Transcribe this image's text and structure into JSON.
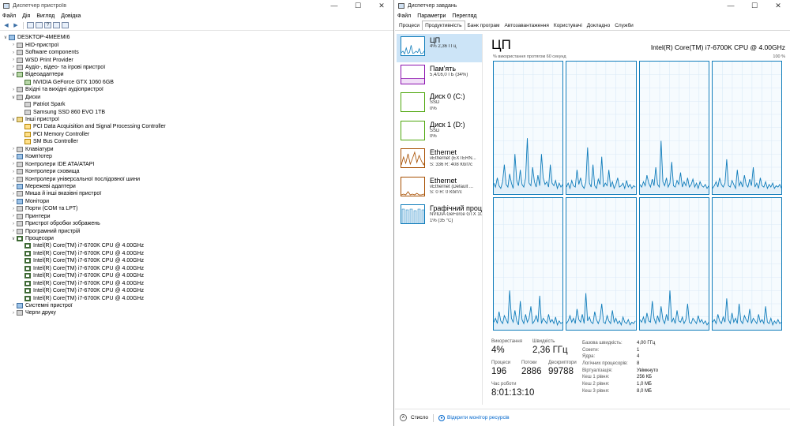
{
  "device_manager": {
    "title": "Диспетчер пристроїв",
    "menu": [
      "Файл",
      "Дія",
      "Вигляд",
      "Довідка"
    ],
    "tree": [
      {
        "depth": 0,
        "expand": "open",
        "icon": "computer-icon",
        "label": "DESKTOP-4MEEMI6"
      },
      {
        "depth": 1,
        "expand": "closed",
        "icon": "hid-icon",
        "label": "HID-пристрої"
      },
      {
        "depth": 1,
        "expand": "closed",
        "icon": "software-components-icon",
        "label": "Software components"
      },
      {
        "depth": 1,
        "expand": "closed",
        "icon": "printer-icon",
        "label": "WSD Print Provider"
      },
      {
        "depth": 1,
        "expand": "closed",
        "icon": "speaker-icon",
        "label": "Аудіо-, відео- та ігрові пристрої"
      },
      {
        "depth": 1,
        "expand": "open",
        "icon": "display-adapter-icon",
        "label": "Відеоадаптери"
      },
      {
        "depth": 2,
        "expand": "none",
        "icon": "display-adapter-icon",
        "label": "NVIDIA GeForce GTX 1060 6GB"
      },
      {
        "depth": 1,
        "expand": "closed",
        "icon": "audio-io-icon",
        "label": "Вхідні та вихідні аудіопристрої"
      },
      {
        "depth": 1,
        "expand": "open",
        "icon": "disk-icon",
        "label": "Диски"
      },
      {
        "depth": 2,
        "expand": "none",
        "icon": "disk-icon",
        "label": "Patriot Spark"
      },
      {
        "depth": 2,
        "expand": "none",
        "icon": "disk-icon",
        "label": "Samsung SSD 860 EVO 1TB"
      },
      {
        "depth": 1,
        "expand": "open",
        "icon": "other-devices-icon",
        "label": "Інші пристрої"
      },
      {
        "depth": 2,
        "expand": "none",
        "icon": "warning-device-icon",
        "label": "PCI Data Acquisition and Signal Processing Controller"
      },
      {
        "depth": 2,
        "expand": "none",
        "icon": "warning-device-icon",
        "label": "PCI Memory Controller"
      },
      {
        "depth": 2,
        "expand": "none",
        "icon": "warning-device-icon",
        "label": "SM Bus Controller"
      },
      {
        "depth": 1,
        "expand": "closed",
        "icon": "keyboard-icon",
        "label": "Клавіатури"
      },
      {
        "depth": 1,
        "expand": "closed",
        "icon": "computer-icon",
        "label": "Комп'ютер"
      },
      {
        "depth": 1,
        "expand": "closed",
        "icon": "ide-controller-icon",
        "label": "Контролери IDE ATA/ATAPI"
      },
      {
        "depth": 1,
        "expand": "closed",
        "icon": "storage-controller-icon",
        "label": "Контролери сховища"
      },
      {
        "depth": 1,
        "expand": "closed",
        "icon": "usb-controller-icon",
        "label": "Контролери універсальної послідовної шини"
      },
      {
        "depth": 1,
        "expand": "closed",
        "icon": "network-adapter-icon",
        "label": "Мережеві адаптери"
      },
      {
        "depth": 1,
        "expand": "closed",
        "icon": "mouse-icon",
        "label": "Миша й інші вказівні пристрої"
      },
      {
        "depth": 1,
        "expand": "closed",
        "icon": "monitor-icon",
        "label": "Монітори"
      },
      {
        "depth": 1,
        "expand": "closed",
        "icon": "port-icon",
        "label": "Порти (COM та LPT)"
      },
      {
        "depth": 1,
        "expand": "closed",
        "icon": "printer-icon",
        "label": "Принтери"
      },
      {
        "depth": 1,
        "expand": "closed",
        "icon": "imaging-device-icon",
        "label": "Пристрої обробки зображень"
      },
      {
        "depth": 1,
        "expand": "closed",
        "icon": "software-device-icon",
        "label": "Програмний пристрій"
      },
      {
        "depth": 1,
        "expand": "open",
        "icon": "processor-icon",
        "label": "Процесори"
      },
      {
        "depth": 2,
        "expand": "none",
        "icon": "processor-icon",
        "label": "Intel(R) Core(TM) i7-6700K CPU @ 4.00GHz"
      },
      {
        "depth": 2,
        "expand": "none",
        "icon": "processor-icon",
        "label": "Intel(R) Core(TM) i7-6700K CPU @ 4.00GHz"
      },
      {
        "depth": 2,
        "expand": "none",
        "icon": "processor-icon",
        "label": "Intel(R) Core(TM) i7-6700K CPU @ 4.00GHz"
      },
      {
        "depth": 2,
        "expand": "none",
        "icon": "processor-icon",
        "label": "Intel(R) Core(TM) i7-6700K CPU @ 4.00GHz"
      },
      {
        "depth": 2,
        "expand": "none",
        "icon": "processor-icon",
        "label": "Intel(R) Core(TM) i7-6700K CPU @ 4.00GHz"
      },
      {
        "depth": 2,
        "expand": "none",
        "icon": "processor-icon",
        "label": "Intel(R) Core(TM) i7-6700K CPU @ 4.00GHz"
      },
      {
        "depth": 2,
        "expand": "none",
        "icon": "processor-icon",
        "label": "Intel(R) Core(TM) i7-6700K CPU @ 4.00GHz"
      },
      {
        "depth": 2,
        "expand": "none",
        "icon": "processor-icon",
        "label": "Intel(R) Core(TM) i7-6700K CPU @ 4.00GHz"
      },
      {
        "depth": 1,
        "expand": "closed",
        "icon": "system-devices-icon",
        "label": "Системні пристрої"
      },
      {
        "depth": 1,
        "expand": "closed",
        "icon": "print-queue-icon",
        "label": "Черги друку"
      }
    ]
  },
  "task_manager": {
    "title": "Диспетчер завдань",
    "menu": [
      "Файл",
      "Параметри",
      "Перегляд"
    ],
    "tabs": [
      "Процеси",
      "Продуктивність",
      "Банк програм",
      "Автозавантаження",
      "Користувачі",
      "Докладно",
      "Служби"
    ],
    "active_tab": "Продуктивність",
    "sidebar": [
      {
        "name": "ЦП",
        "sub1": "4% 2,36 ГГц",
        "sub2": "",
        "kind": "cpu",
        "selected": true
      },
      {
        "name": "Пам'ять",
        "sub1": "5,4/16,0 ГБ (34%)",
        "sub2": "",
        "kind": "mem",
        "selected": false
      },
      {
        "name": "Диск 0 (C:)",
        "sub1": "SSD",
        "sub2": "0%",
        "kind": "disk",
        "selected": false
      },
      {
        "name": "Диск 1 (D:)",
        "sub1": "SSD",
        "sub2": "0%",
        "kind": "disk",
        "selected": false
      },
      {
        "name": "Ethernet",
        "sub1": "vEthernet (EXTERN...",
        "sub2": "S: 336 R: 408 Кбіт/с",
        "kind": "net",
        "selected": false
      },
      {
        "name": "Ethernet",
        "sub1": "vEthernet (Default ...",
        "sub2": "S: 0 R: 0 Кбіт/с",
        "kind": "net",
        "selected": false
      },
      {
        "name": "Графічний процес",
        "sub1": "NVIDIA GeForce GTX 106",
        "sub2": "1% (35 °C)",
        "kind": "gpu",
        "selected": false
      }
    ],
    "cpu": {
      "title": "ЦП",
      "model": "Intel(R) Core(TM) i7-6700K CPU @ 4.00GHz",
      "graph_caption": "% використання протягом 60 секунд",
      "graph_max": "100 %",
      "stats": {
        "utilization_label": "Використання",
        "utilization": "4%",
        "speed_label": "Швидкість",
        "speed": "2,36 ГГц",
        "processes_label": "Процеси",
        "processes": "196",
        "threads_label": "Потоки",
        "threads": "2886",
        "handles_label": "Дескриптори",
        "handles": "99788",
        "uptime_label": "Час роботи",
        "uptime": "8:01:13:10"
      },
      "details": [
        {
          "k": "Базова швидкість:",
          "v": "4,00 ГГц"
        },
        {
          "k": "Сокети:",
          "v": "1"
        },
        {
          "k": "Ядра:",
          "v": "4"
        },
        {
          "k": "Логічних процесорів:",
          "v": "8"
        },
        {
          "k": "Віртуалізація:",
          "v": "Увімкнуто"
        },
        {
          "k": "Кеш 1 рівня:",
          "v": "256 КБ"
        },
        {
          "k": "Кеш 2 рівня:",
          "v": "1,0 МБ"
        },
        {
          "k": "Кеш 3 рівня:",
          "v": "8,0 МБ"
        }
      ],
      "core_series": [
        [
          8,
          5,
          12,
          6,
          4,
          9,
          22,
          7,
          5,
          15,
          8,
          4,
          30,
          10,
          6,
          18,
          7,
          5,
          12,
          42,
          8,
          6,
          20,
          9,
          5,
          14,
          6,
          30,
          12,
          7,
          9,
          5,
          22,
          8,
          6,
          10,
          4,
          8,
          5,
          7
        ],
        [
          5,
          8,
          4,
          10,
          6,
          5,
          18,
          7,
          12,
          6,
          4,
          9,
          35,
          8,
          5,
          22,
          6,
          4,
          11,
          7,
          28,
          5,
          8,
          6,
          18,
          5,
          9,
          4,
          7,
          12,
          5,
          6,
          8,
          4,
          10,
          5,
          7,
          4,
          6,
          5
        ],
        [
          7,
          5,
          9,
          6,
          14,
          8,
          5,
          11,
          6,
          20,
          7,
          5,
          40,
          9,
          6,
          12,
          5,
          8,
          24,
          6,
          5,
          10,
          7,
          16,
          5,
          9,
          6,
          12,
          5,
          7,
          11,
          5,
          8,
          4,
          9,
          6,
          5,
          7,
          4,
          6
        ],
        [
          4,
          6,
          9,
          5,
          12,
          7,
          5,
          8,
          26,
          6,
          5,
          10,
          7,
          4,
          18,
          6,
          9,
          5,
          14,
          7,
          5,
          11,
          6,
          20,
          5,
          8,
          4,
          12,
          6,
          5,
          9,
          4,
          7,
          5,
          8,
          4,
          6,
          5,
          7,
          4
        ],
        [
          6,
          9,
          5,
          14,
          7,
          5,
          11,
          8,
          5,
          30,
          9,
          6,
          15,
          7,
          4,
          22,
          8,
          5,
          12,
          6,
          9,
          18,
          5,
          7,
          11,
          6,
          26,
          5,
          9,
          7,
          5,
          12,
          6,
          8,
          5,
          10,
          4,
          7,
          5,
          6
        ],
        [
          5,
          7,
          11,
          6,
          9,
          5,
          16,
          8,
          6,
          12,
          5,
          28,
          7,
          10,
          6,
          5,
          14,
          8,
          5,
          9,
          20,
          6,
          5,
          11,
          7,
          5,
          15,
          6,
          9,
          5,
          7,
          4,
          10,
          6,
          5,
          8,
          4,
          6,
          5,
          7
        ],
        [
          8,
          6,
          10,
          5,
          13,
          7,
          6,
          22,
          9,
          5,
          11,
          6,
          18,
          8,
          5,
          12,
          7,
          30,
          6,
          9,
          5,
          15,
          7,
          6,
          10,
          5,
          8,
          20,
          6,
          5,
          9,
          7,
          5,
          11,
          6,
          8,
          5,
          7,
          4,
          6
        ],
        [
          6,
          8,
          5,
          12,
          7,
          5,
          10,
          6,
          24,
          8,
          5,
          13,
          6,
          9,
          5,
          20,
          7,
          5,
          11,
          8,
          6,
          16,
          5,
          9,
          7,
          5,
          12,
          6,
          8,
          5,
          18,
          6,
          5,
          9,
          4,
          7,
          5,
          8,
          5,
          6
        ]
      ]
    },
    "footer": {
      "collapse_label": "Стисло",
      "resource_monitor_label": "Відкрити монітор ресурсів"
    }
  }
}
